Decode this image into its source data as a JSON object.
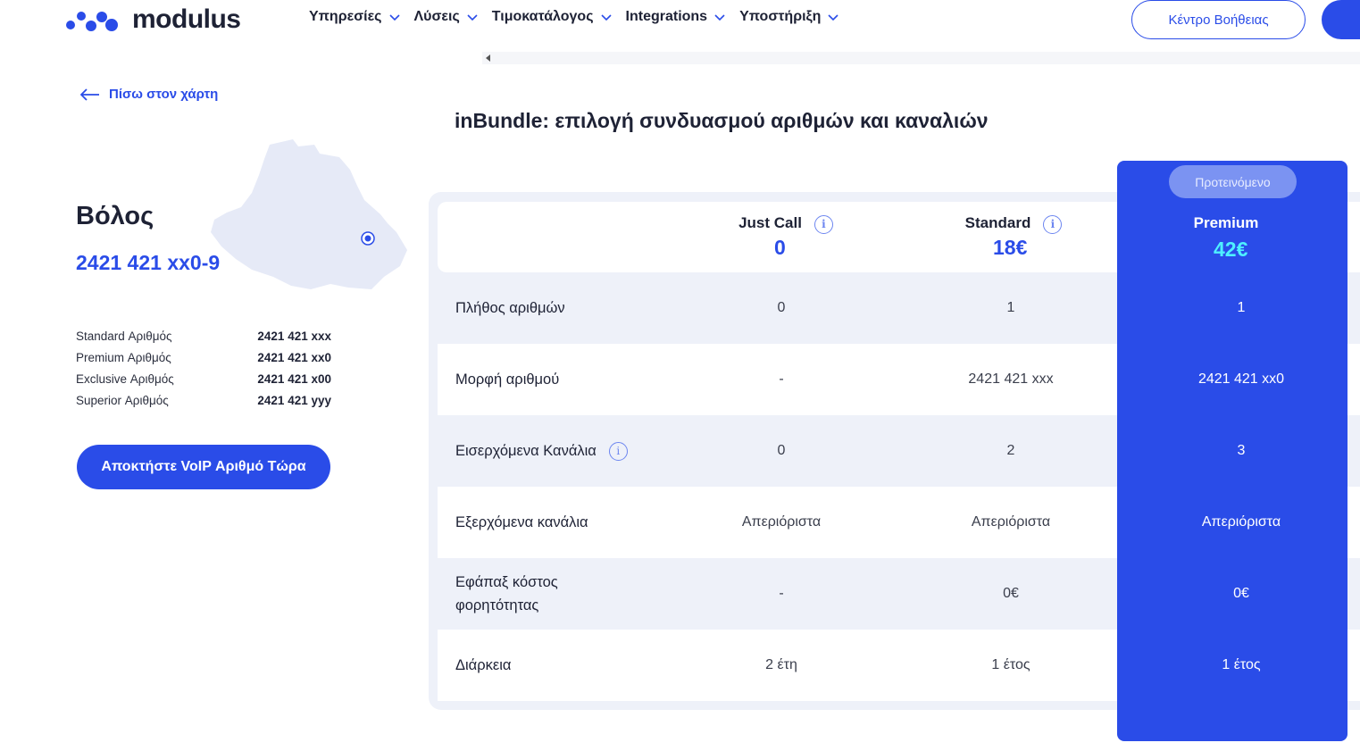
{
  "header": {
    "logo_text": "modulus",
    "nav": [
      "Υπηρεσίες",
      "Λύσεις",
      "Τιμοκατάλογος",
      "Integrations",
      "Υποστήριξη"
    ],
    "help_button": "Κέντρο Βοήθειας"
  },
  "left": {
    "back_link": "Πίσω στον χάρτη",
    "city": "Βόλος",
    "range": "2421 421 xx0-9",
    "numbers": [
      {
        "label": "Standard Αριθμός",
        "value": "2421 421 xxx"
      },
      {
        "label": "Premium Αριθμός",
        "value": "2421 421 xx0"
      },
      {
        "label": "Exclusive Αριθμός",
        "value": "2421 421 x00"
      },
      {
        "label": "Superior Αριθμός",
        "value": "2421 421 yyy"
      }
    ],
    "cta": "Αποκτήστε VoIP Αριθμό Τώρα"
  },
  "pricing": {
    "title": "inBundle: επιλογή συνδυασμού αριθμών και καναλιών",
    "badge": "Προτεινόμενο",
    "plans": [
      {
        "name": "Just Call",
        "price": "0"
      },
      {
        "name": "Standard",
        "price": "18€"
      },
      {
        "name": "Premium",
        "price": "42€"
      }
    ],
    "rows": [
      {
        "label": "Πλήθος αριθμών",
        "values": [
          "0",
          "1",
          "1"
        ]
      },
      {
        "label": "Μορφή αριθμού",
        "values": [
          "-",
          "2421 421 xxx",
          "2421 421 xx0"
        ]
      },
      {
        "label": "Εισερχόμενα Κανάλια",
        "values": [
          "0",
          "2",
          "3"
        ]
      },
      {
        "label": "Εξερχόμενα κανάλια",
        "values": [
          "Απεριόριστα",
          "Απεριόριστα",
          "Απεριόριστα"
        ]
      },
      {
        "label": "Εφάπαξ κόστος φορητότητας",
        "values": [
          "-",
          "0€",
          "0€"
        ]
      },
      {
        "label": "Διάρκεια",
        "values": [
          "2 έτη",
          "1 έτος",
          "1 έτος"
        ]
      }
    ]
  },
  "colors": {
    "brand": "#2a4ce8",
    "premium_price": "#4ef0ff",
    "badge": "#7b93f2"
  }
}
